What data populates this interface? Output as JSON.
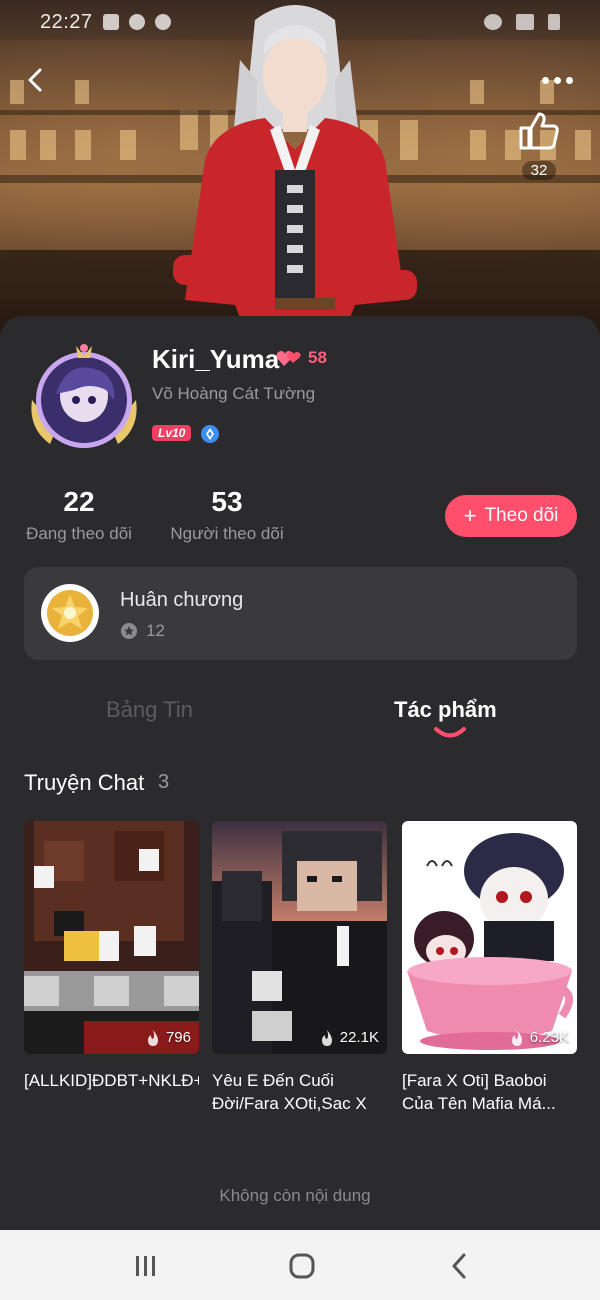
{
  "status_bar": {
    "time": "22:27"
  },
  "header": {
    "like_count": "32"
  },
  "profile": {
    "username": "Kiri_Yuma",
    "heart_count": "58",
    "display_name": "Võ Hoàng Cát Tường",
    "level": "Lv10"
  },
  "stats": {
    "following_count": "22",
    "following_label": "Đang theo dõi",
    "followers_count": "53",
    "followers_label": "Người theo dõi"
  },
  "follow_button": {
    "plus": "+",
    "label": "Theo dõi"
  },
  "medals": {
    "title": "Huân chương",
    "count": "12"
  },
  "tabs": [
    {
      "label": "Bảng Tin",
      "active": false
    },
    {
      "label": "Tác phẩm",
      "active": true
    }
  ],
  "section": {
    "title": "Truyện Chat",
    "count": "3"
  },
  "stories": [
    {
      "title": "[ALLKID]ĐDBT+NKLĐ+LR",
      "views": "796"
    },
    {
      "title": "Yêu E Đến Cuối Đời/Fara XOti,Sac X Fed/",
      "views": "22.1K"
    },
    {
      "title": "[Fara X Oti] Baoboi Của Tên Mafia Má...",
      "views": "6.23K"
    }
  ],
  "footer": {
    "end_text": "Không còn nội dung"
  },
  "colors": {
    "accent": "#ff4f6d",
    "background": "#2b2b2d",
    "card": "#3a3a3d",
    "muted": "#9a9a9e"
  }
}
